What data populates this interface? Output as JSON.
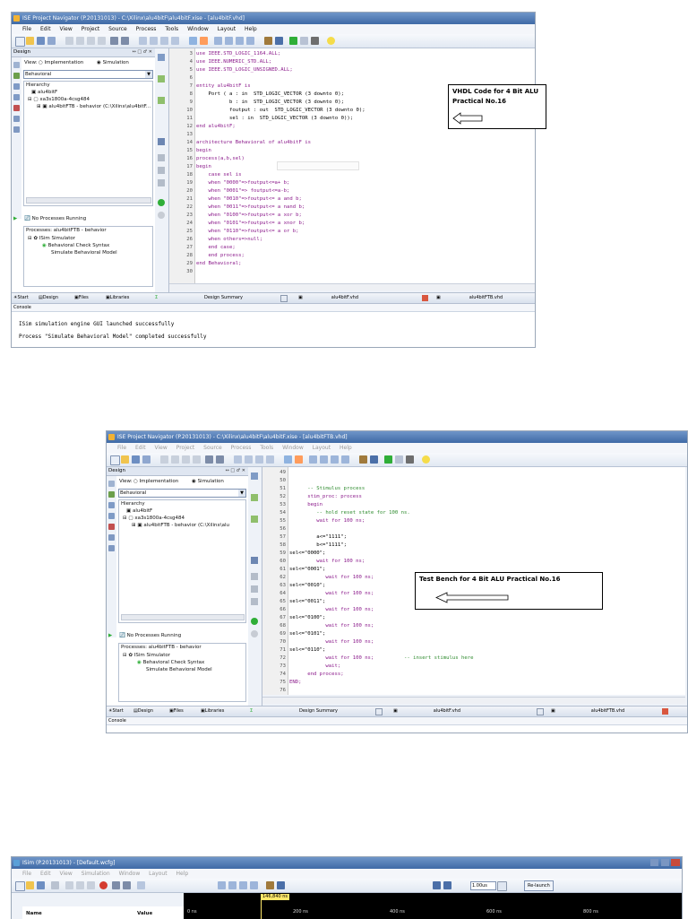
{
  "shot1": {
    "title": "ISE Project Navigator (P.20131013) - C:\\Xilinx\\alu4bitF\\alu4bitF.xise - [alu4bitF.vhd]",
    "menu": [
      "File",
      "Edit",
      "View",
      "Project",
      "Source",
      "Process",
      "Tools",
      "Window",
      "Layout",
      "Help"
    ],
    "design_label": "Design",
    "view_label": "View:",
    "impl_label": "Implementation",
    "sim_label": "Simulation",
    "behavioral": "Behavioral",
    "hierarchy": "Hierarchy",
    "tree": [
      "alu4bitF",
      "xa3s1800a-4csg484",
      "alu4bitFTB - behavior (C:\\Xilinx\\alu4bitF..."
    ],
    "no_proc": "No Processes Running",
    "processes_label": "Processes: alu4bitFTB - behavior",
    "proc_items": [
      "ISim Simulator",
      "Behavioral Check Syntax",
      "Simulate Behavioral Model"
    ],
    "bottom_tabs": [
      "Start",
      "Design",
      "Files",
      "Libraries"
    ],
    "doc_tabs": [
      "Design Summary",
      "alu4bitF.vhd",
      "alu4bitFTB.vhd"
    ],
    "console_label": "Console",
    "console_lines": [
      "ISim simulation engine GUI launched successfully",
      "Process \"Simulate Behavioral Model\" completed successfully"
    ],
    "note": "VHDL Code for 4 Bit ALU Practical No.16",
    "code": [
      {
        "n": "3",
        "t": "use IEEE.STD_LOGIC_1164.ALL;"
      },
      {
        "n": "4",
        "t": "use IEEE.NUMERIC_STD.ALL;"
      },
      {
        "n": "5",
        "t": "use IEEE.STD_LOGIC_UNSIGNED.ALL;"
      },
      {
        "n": "6",
        "t": ""
      },
      {
        "n": "7",
        "t": "entity alu4bitF is"
      },
      {
        "n": "8",
        "t": "    Port ( a : in  STD_LOGIC_VECTOR (3 downto 0);"
      },
      {
        "n": "9",
        "t": "           b : in  STD_LOGIC_VECTOR (3 downto 0);"
      },
      {
        "n": "10",
        "t": "           foutput : out  STD_LOGIC_VECTOR (3 downto 0);"
      },
      {
        "n": "11",
        "t": "           sel : in  STD_LOGIC_VECTOR (3 downto 0));"
      },
      {
        "n": "12",
        "t": "end alu4bitF;"
      },
      {
        "n": "13",
        "t": ""
      },
      {
        "n": "14",
        "t": "architecture Behavioral of alu4bitF is"
      },
      {
        "n": "15",
        "t": "begin"
      },
      {
        "n": "16",
        "t": "process(a,b,sel)"
      },
      {
        "n": "17",
        "t": "begin"
      },
      {
        "n": "18",
        "t": "    case sel is"
      },
      {
        "n": "19",
        "t": "    when \"0000\"=>foutput<=a+ b;"
      },
      {
        "n": "20",
        "t": "    when \"0001\"=> foutput<=a-b;"
      },
      {
        "n": "21",
        "t": "    when \"0010\"=>foutput<= a and b;"
      },
      {
        "n": "22",
        "t": "    when \"0011\"=>foutput<= a nand b;"
      },
      {
        "n": "23",
        "t": "    when \"0100\"=>foutput<= a xor b;"
      },
      {
        "n": "24",
        "t": "    when \"0101\"=>foutput<= a xnor b;"
      },
      {
        "n": "25",
        "t": "    when \"0110\"=>foutput<= a or b;"
      },
      {
        "n": "26",
        "t": "    when others=>null;"
      },
      {
        "n": "27",
        "t": "    end case;"
      },
      {
        "n": "28",
        "t": "    end process;"
      },
      {
        "n": "29",
        "t": "end Behavioral;"
      },
      {
        "n": "30",
        "t": ""
      }
    ]
  },
  "shot2": {
    "title": "ISE Project Navigator (P.20131013) - C:\\Xilinx\\alu4bitF\\alu4bitF.xise - [alu4bitFTB.vhd]",
    "menu": [
      "File",
      "Edit",
      "View",
      "Project",
      "Source",
      "Process",
      "Tools",
      "Window",
      "Layout",
      "Help"
    ],
    "design_label": "Design",
    "view_label": "View:",
    "impl_label": "Implementation",
    "sim_label": "Simulation",
    "behavioral": "Behavioral",
    "hierarchy": "Hierarchy",
    "tree": [
      "alu4bitF",
      "xa3s1800a-4csg484",
      "alu4bitFTB - behavior (C:\\Xilinx\\alu"
    ],
    "no_proc": "No Processes Running",
    "processes_label": "Processes: alu4bitFTB - behavior",
    "proc_items": [
      "ISim Simulator",
      "Behavioral Check Syntax",
      "Simulate Behavioral Model"
    ],
    "bottom_tabs": [
      "Start",
      "Design",
      "Files",
      "Libraries"
    ],
    "doc_tabs": [
      "Design Summary",
      "alu4bitF.vhd",
      "alu4bitFTB.vhd"
    ],
    "console_label": "Console",
    "note": "Test Bench for 4 Bit ALU Practical No.16",
    "code": [
      {
        "n": "49",
        "t": ""
      },
      {
        "n": "50",
        "t": ""
      },
      {
        "n": "51",
        "t": "      -- Stimulus process"
      },
      {
        "n": "52",
        "t": "      stim_proc: process"
      },
      {
        "n": "53",
        "t": "      begin"
      },
      {
        "n": "54",
        "t": "         -- hold reset state for 100 ns."
      },
      {
        "n": "55",
        "t": "         wait for 100 ns;"
      },
      {
        "n": "56",
        "t": ""
      },
      {
        "n": "57",
        "t": "         a<=\"1111\";"
      },
      {
        "n": "58",
        "t": "         b<=\"1111\";"
      },
      {
        "n": "59",
        "t": "sel<=\"0000\";"
      },
      {
        "n": "60",
        "t": "         wait for 100 ns;"
      },
      {
        "n": "61",
        "t": "sel<=\"0001\";"
      },
      {
        "n": "62",
        "t": "            wait for 100 ns;"
      },
      {
        "n": "63",
        "t": "sel<=\"0010\";"
      },
      {
        "n": "64",
        "t": "            wait for 100 ns;"
      },
      {
        "n": "65",
        "t": "sel<=\"0011\";"
      },
      {
        "n": "66",
        "t": "            wait for 100 ns;"
      },
      {
        "n": "67",
        "t": "sel<=\"0100\";"
      },
      {
        "n": "68",
        "t": "            wait for 100 ns;"
      },
      {
        "n": "69",
        "t": "sel<=\"0101\";"
      },
      {
        "n": "70",
        "t": "            wait for 100 ns;"
      },
      {
        "n": "71",
        "t": "sel<=\"0110\";"
      },
      {
        "n": "72",
        "t": "            wait for 100 ns;          -- insert stimulus here"
      },
      {
        "n": "73",
        "t": "            wait;"
      },
      {
        "n": "74",
        "t": "      end process;"
      },
      {
        "n": "75",
        "t": "END;"
      },
      {
        "n": "76",
        "t": ""
      }
    ]
  },
  "shot3": {
    "title": "ISim (P.20131013) - [Default.wcfg]",
    "menu": [
      "File",
      "Edit",
      "View",
      "Simulation",
      "Window",
      "Layout",
      "Help"
    ],
    "time_field": "1.00us",
    "relaunch": "Re-launch",
    "cursor_time": "146,840 ns",
    "col_name": "Name",
    "col_value": "Value",
    "ticks": [
      "0 ns",
      "200 ns",
      "400 ns",
      "600 ns",
      "800 ns"
    ]
  }
}
